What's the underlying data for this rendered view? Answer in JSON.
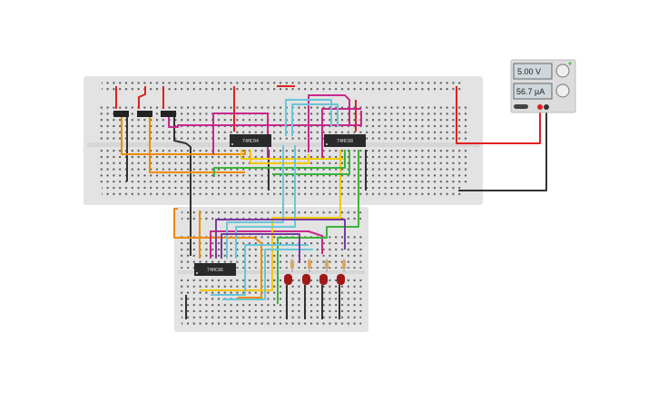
{
  "power_supply": {
    "voltage": "5.00 V",
    "current": "56.7 µA",
    "led_color": "#3ec43e",
    "positive_color": "#e02020",
    "negative_color": "#333333"
  },
  "chips": [
    {
      "label": "74HC04"
    },
    {
      "label": "74HC08"
    },
    {
      "label": "74HC86"
    }
  ],
  "led_color": "#a01818",
  "wire_colors": {
    "red": "#e02020",
    "black": "#333333",
    "orange": "#f08a00",
    "yellow": "#f5c800",
    "green": "#3cb43c",
    "cyan": "#6ac6d8",
    "magenta": "#c8288c",
    "purple": "#7a3aa0"
  }
}
